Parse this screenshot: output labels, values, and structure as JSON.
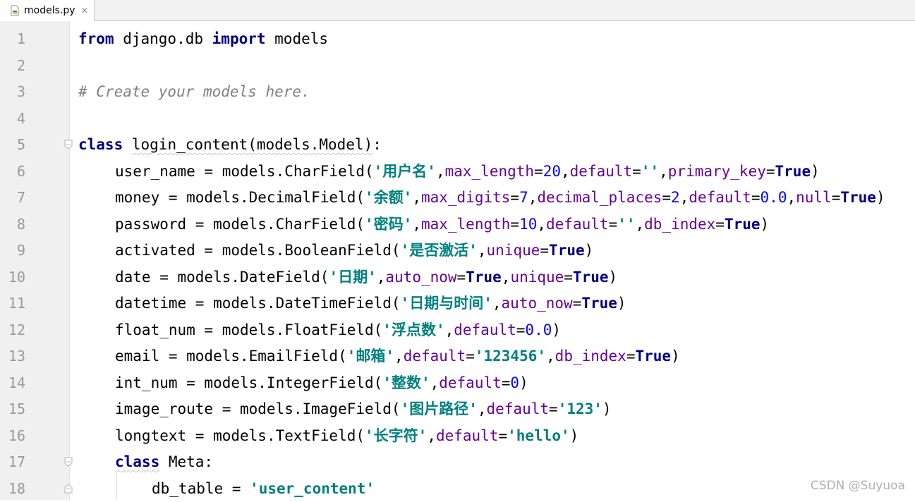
{
  "tab": {
    "file_name": "models.py",
    "close_glyph": "×",
    "icon": "python-file-icon"
  },
  "lines": [
    {
      "n": "1",
      "tokens": [
        {
          "t": "from",
          "c": "kw"
        },
        {
          "t": " django.db ",
          "c": ""
        },
        {
          "t": "import",
          "c": "kw"
        },
        {
          "t": " models",
          "c": ""
        }
      ]
    },
    {
      "n": "2",
      "tokens": []
    },
    {
      "n": "3",
      "tokens": [
        {
          "t": "# Create your models here.",
          "c": "cm"
        }
      ]
    },
    {
      "n": "4",
      "tokens": []
    },
    {
      "n": "5",
      "fold": "open",
      "tokens": [
        {
          "t": "class",
          "c": "kw"
        },
        {
          "t": " ",
          "c": ""
        },
        {
          "t": "login_content(models.Model)",
          "c": "squiggle"
        },
        {
          "t": ":",
          "c": ""
        }
      ]
    },
    {
      "n": "6",
      "indent": 1,
      "tokens": [
        {
          "t": "user_name = models.CharField(",
          "c": ""
        },
        {
          "t": "'用户名'",
          "c": "str"
        },
        {
          "t": ",",
          "c": ""
        },
        {
          "t": "max_length",
          "c": "kwarg"
        },
        {
          "t": "=",
          "c": ""
        },
        {
          "t": "20",
          "c": "num"
        },
        {
          "t": ",",
          "c": ""
        },
        {
          "t": "default",
          "c": "kwarg"
        },
        {
          "t": "=",
          "c": ""
        },
        {
          "t": "''",
          "c": "str"
        },
        {
          "t": ",",
          "c": ""
        },
        {
          "t": "primary_key",
          "c": "kwarg"
        },
        {
          "t": "=",
          "c": ""
        },
        {
          "t": "True",
          "c": "kw"
        },
        {
          "t": ")",
          "c": ""
        }
      ]
    },
    {
      "n": "7",
      "indent": 1,
      "tokens": [
        {
          "t": "money = models.DecimalField(",
          "c": ""
        },
        {
          "t": "'余额'",
          "c": "str"
        },
        {
          "t": ",",
          "c": ""
        },
        {
          "t": "max_digits",
          "c": "kwarg"
        },
        {
          "t": "=",
          "c": ""
        },
        {
          "t": "7",
          "c": "num"
        },
        {
          "t": ",",
          "c": ""
        },
        {
          "t": "decimal_places",
          "c": "kwarg"
        },
        {
          "t": "=",
          "c": ""
        },
        {
          "t": "2",
          "c": "num"
        },
        {
          "t": ",",
          "c": ""
        },
        {
          "t": "default",
          "c": "kwarg"
        },
        {
          "t": "=",
          "c": ""
        },
        {
          "t": "0.0",
          "c": "num"
        },
        {
          "t": ",",
          "c": ""
        },
        {
          "t": "null",
          "c": "kwarg"
        },
        {
          "t": "=",
          "c": ""
        },
        {
          "t": "True",
          "c": "kw"
        },
        {
          "t": ")",
          "c": ""
        }
      ]
    },
    {
      "n": "8",
      "indent": 1,
      "tokens": [
        {
          "t": "password = models.CharField(",
          "c": ""
        },
        {
          "t": "'密码'",
          "c": "str"
        },
        {
          "t": ",",
          "c": ""
        },
        {
          "t": "max_length",
          "c": "kwarg"
        },
        {
          "t": "=",
          "c": ""
        },
        {
          "t": "10",
          "c": "num"
        },
        {
          "t": ",",
          "c": ""
        },
        {
          "t": "default",
          "c": "kwarg"
        },
        {
          "t": "=",
          "c": ""
        },
        {
          "t": "''",
          "c": "str"
        },
        {
          "t": ",",
          "c": ""
        },
        {
          "t": "db_index",
          "c": "kwarg"
        },
        {
          "t": "=",
          "c": ""
        },
        {
          "t": "True",
          "c": "kw"
        },
        {
          "t": ")",
          "c": ""
        }
      ]
    },
    {
      "n": "9",
      "indent": 1,
      "tokens": [
        {
          "t": "activated = models.BooleanField(",
          "c": ""
        },
        {
          "t": "'是否激活'",
          "c": "str"
        },
        {
          "t": ",",
          "c": ""
        },
        {
          "t": "unique",
          "c": "kwarg"
        },
        {
          "t": "=",
          "c": ""
        },
        {
          "t": "True",
          "c": "kw"
        },
        {
          "t": ")",
          "c": ""
        }
      ]
    },
    {
      "n": "10",
      "indent": 1,
      "tokens": [
        {
          "t": "date = models.DateField(",
          "c": ""
        },
        {
          "t": "'日期'",
          "c": "str"
        },
        {
          "t": ",",
          "c": ""
        },
        {
          "t": "auto_now",
          "c": "kwarg"
        },
        {
          "t": "=",
          "c": ""
        },
        {
          "t": "True",
          "c": "kw"
        },
        {
          "t": ",",
          "c": ""
        },
        {
          "t": "unique",
          "c": "kwarg"
        },
        {
          "t": "=",
          "c": ""
        },
        {
          "t": "True",
          "c": "kw"
        },
        {
          "t": ")",
          "c": ""
        }
      ]
    },
    {
      "n": "11",
      "indent": 1,
      "tokens": [
        {
          "t": "datetime = models.DateTimeField(",
          "c": ""
        },
        {
          "t": "'日期与时间'",
          "c": "str"
        },
        {
          "t": ",",
          "c": ""
        },
        {
          "t": "auto_now",
          "c": "kwarg"
        },
        {
          "t": "=",
          "c": ""
        },
        {
          "t": "True",
          "c": "kw"
        },
        {
          "t": ")",
          "c": ""
        }
      ]
    },
    {
      "n": "12",
      "indent": 1,
      "tokens": [
        {
          "t": "float_num = models.FloatField(",
          "c": ""
        },
        {
          "t": "'浮点数'",
          "c": "str"
        },
        {
          "t": ",",
          "c": ""
        },
        {
          "t": "default",
          "c": "kwarg"
        },
        {
          "t": "=",
          "c": ""
        },
        {
          "t": "0.0",
          "c": "num"
        },
        {
          "t": ")",
          "c": ""
        }
      ]
    },
    {
      "n": "13",
      "indent": 1,
      "tokens": [
        {
          "t": "email = models.EmailField(",
          "c": ""
        },
        {
          "t": "'邮箱'",
          "c": "str"
        },
        {
          "t": ",",
          "c": ""
        },
        {
          "t": "default",
          "c": "kwarg"
        },
        {
          "t": "=",
          "c": ""
        },
        {
          "t": "'123456'",
          "c": "str"
        },
        {
          "t": ",",
          "c": ""
        },
        {
          "t": "db_index",
          "c": "kwarg"
        },
        {
          "t": "=",
          "c": ""
        },
        {
          "t": "True",
          "c": "kw"
        },
        {
          "t": ")",
          "c": ""
        }
      ]
    },
    {
      "n": "14",
      "indent": 1,
      "tokens": [
        {
          "t": "int_num = models.IntegerField(",
          "c": ""
        },
        {
          "t": "'整数'",
          "c": "str"
        },
        {
          "t": ",",
          "c": ""
        },
        {
          "t": "default",
          "c": "kwarg"
        },
        {
          "t": "=",
          "c": ""
        },
        {
          "t": "0",
          "c": "num"
        },
        {
          "t": ")",
          "c": ""
        }
      ]
    },
    {
      "n": "15",
      "indent": 1,
      "tokens": [
        {
          "t": "image_route = models.ImageField(",
          "c": ""
        },
        {
          "t": "'图片路径'",
          "c": "str"
        },
        {
          "t": ",",
          "c": ""
        },
        {
          "t": "default",
          "c": "kwarg"
        },
        {
          "t": "=",
          "c": ""
        },
        {
          "t": "'123'",
          "c": "str"
        },
        {
          "t": ")",
          "c": ""
        }
      ]
    },
    {
      "n": "16",
      "indent": 1,
      "tokens": [
        {
          "t": "longtext = models.TextField(",
          "c": ""
        },
        {
          "t": "'长字符'",
          "c": "str"
        },
        {
          "t": ",",
          "c": ""
        },
        {
          "t": "default",
          "c": "kwarg"
        },
        {
          "t": "=",
          "c": ""
        },
        {
          "t": "'hello'",
          "c": "str"
        },
        {
          "t": ")",
          "c": ""
        }
      ]
    },
    {
      "n": "17",
      "indent": 1,
      "fold": "open",
      "tokens": [
        {
          "t": "class",
          "c": "kw squiggle"
        },
        {
          "t": " Meta:",
          "c": ""
        }
      ]
    },
    {
      "n": "18",
      "indent": 2,
      "fold": "close",
      "tokens": [
        {
          "t": "db_table = ",
          "c": ""
        },
        {
          "t": "'user_content'",
          "c": "str"
        }
      ]
    }
  ],
  "watermark": "CSDN @Suyuoa",
  "colors": {
    "keyword": "#000080",
    "comment": "#808080",
    "string": "#008080",
    "kwarg": "#660099",
    "number": "#0000ff",
    "gutter_bg": "#f0f0f0",
    "line_number": "#999999"
  }
}
